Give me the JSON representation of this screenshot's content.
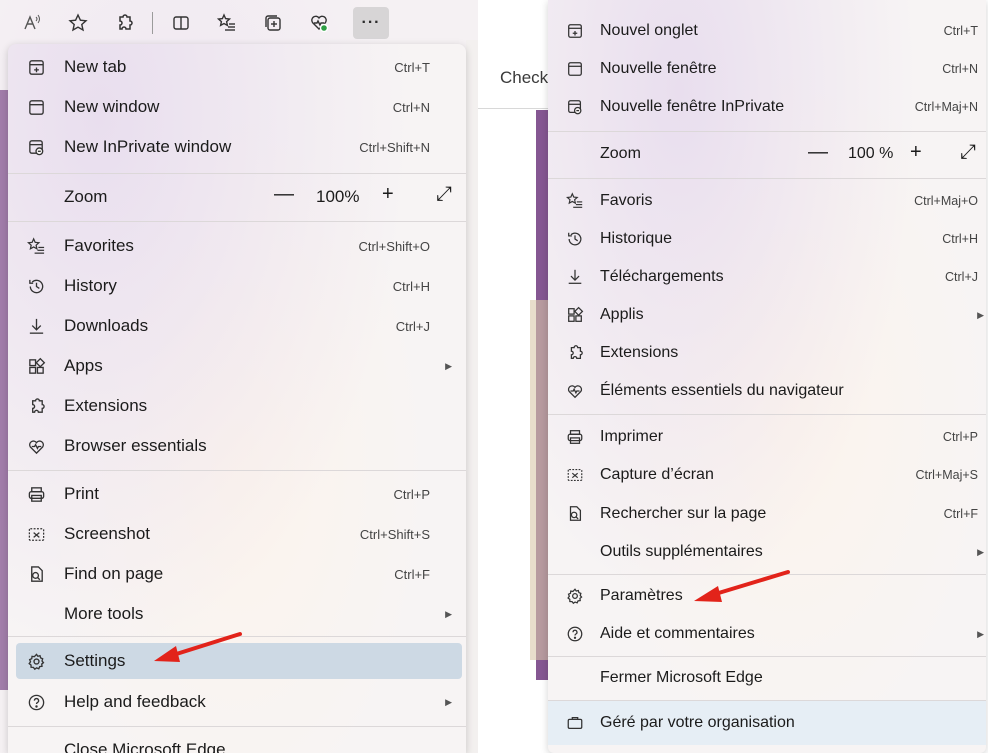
{
  "left": {
    "toolbar": {
      "icons": [
        "read-aloud-icon",
        "favorite-star-icon",
        "extensions-icon",
        "split-screen-icon",
        "favorites-list-icon",
        "collections-icon",
        "browser-essentials-icon",
        "more-icon"
      ],
      "more_label": "···"
    },
    "menu": {
      "new_tab": {
        "label": "New tab",
        "shortcut": "Ctrl+T"
      },
      "new_window": {
        "label": "New window",
        "shortcut": "Ctrl+N"
      },
      "new_inprivate": {
        "label": "New InPrivate window",
        "shortcut": "Ctrl+Shift+N"
      },
      "zoom": {
        "label": "Zoom",
        "minus": "—",
        "value": "100%",
        "plus": "+",
        "expand": "⤢"
      },
      "favorites": {
        "label": "Favorites",
        "shortcut": "Ctrl+Shift+O"
      },
      "history": {
        "label": "History",
        "shortcut": "Ctrl+H"
      },
      "downloads": {
        "label": "Downloads",
        "shortcut": "Ctrl+J"
      },
      "apps": {
        "label": "Apps"
      },
      "extensions": {
        "label": "Extensions"
      },
      "browser_essentials": {
        "label": "Browser essentials"
      },
      "print": {
        "label": "Print",
        "shortcut": "Ctrl+P"
      },
      "screenshot": {
        "label": "Screenshot",
        "shortcut": "Ctrl+Shift+S"
      },
      "find_on_page": {
        "label": "Find on page",
        "shortcut": "Ctrl+F"
      },
      "more_tools": {
        "label": "More tools"
      },
      "settings": {
        "label": "Settings"
      },
      "help": {
        "label": "Help and feedback"
      },
      "close": {
        "label": "Close Microsoft Edge"
      }
    }
  },
  "right": {
    "page_tab": "Check",
    "menu": {
      "new_tab": {
        "label": "Nouvel onglet",
        "shortcut": "Ctrl+T"
      },
      "new_window": {
        "label": "Nouvelle fenêtre",
        "shortcut": "Ctrl+N"
      },
      "new_inprivate": {
        "label": "Nouvelle fenêtre InPrivate",
        "shortcut": "Ctrl+Maj+N"
      },
      "zoom": {
        "label": "Zoom",
        "minus": "—",
        "value": "100 %",
        "plus": "+",
        "expand": "⤢"
      },
      "favorites": {
        "label": "Favoris",
        "shortcut": "Ctrl+Maj+O"
      },
      "history": {
        "label": "Historique",
        "shortcut": "Ctrl+H"
      },
      "downloads": {
        "label": "Téléchargements",
        "shortcut": "Ctrl+J"
      },
      "apps": {
        "label": "Applis"
      },
      "extensions": {
        "label": "Extensions"
      },
      "browser_essentials": {
        "label": "Éléments essentiels du navigateur"
      },
      "print": {
        "label": "Imprimer",
        "shortcut": "Ctrl+P"
      },
      "screenshot": {
        "label": "Capture d’écran",
        "shortcut": "Ctrl+Maj+S"
      },
      "find_on_page": {
        "label": "Rechercher sur la page",
        "shortcut": "Ctrl+F"
      },
      "more_tools": {
        "label": "Outils supplémentaires"
      },
      "settings": {
        "label": "Paramètres"
      },
      "help": {
        "label": "Aide et commentaires"
      },
      "close": {
        "label": "Fermer Microsoft Edge"
      },
      "managed": {
        "label": "Géré par votre organisation"
      }
    }
  },
  "colors": {
    "highlight": "#cdd9e4",
    "arrow": "#e2231a",
    "accent_purple": "#5c1f6e",
    "managed_bg": "#e6eef5"
  }
}
